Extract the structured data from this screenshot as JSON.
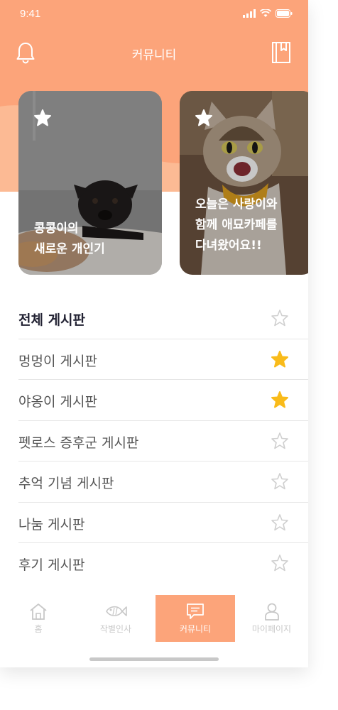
{
  "status_bar": {
    "time": "9:41"
  },
  "header": {
    "title": "커뮤니티",
    "left_icon": "bell-icon",
    "right_icon": "bookmark-book-icon"
  },
  "colors": {
    "accent": "#fca47a",
    "accent_light": "#fcba94",
    "star_filled": "#f9bb1a",
    "star_outline": "#cfcfcf"
  },
  "cards": [
    {
      "caption_line1": "콩콩이의",
      "caption_line2": "새로운 개인기",
      "image": "pug-photo"
    },
    {
      "caption_line1": "오늘은 사랑이와",
      "caption_line2": "함께 애묘카페를",
      "caption_line3": "다녀왔어요!!",
      "image": "cat-photo"
    }
  ],
  "boards": [
    {
      "label": "전체 게시판",
      "favorite": false
    },
    {
      "label": "멍멍이 게시판",
      "favorite": true
    },
    {
      "label": "야옹이 게시판",
      "favorite": true
    },
    {
      "label": "펫로스 증후군 게시판",
      "favorite": false
    },
    {
      "label": "추억 기념 게시판",
      "favorite": false
    },
    {
      "label": "나눔 게시판",
      "favorite": false
    },
    {
      "label": "후기 게시판",
      "favorite": false
    }
  ],
  "tabs": [
    {
      "label": "홈",
      "icon": "home-icon"
    },
    {
      "label": "작별인사",
      "icon": "fish-icon"
    },
    {
      "label": "커뮤니티",
      "icon": "chat-icon"
    },
    {
      "label": "마이페이지",
      "icon": "person-icon"
    }
  ],
  "active_tab": "커뮤니티"
}
